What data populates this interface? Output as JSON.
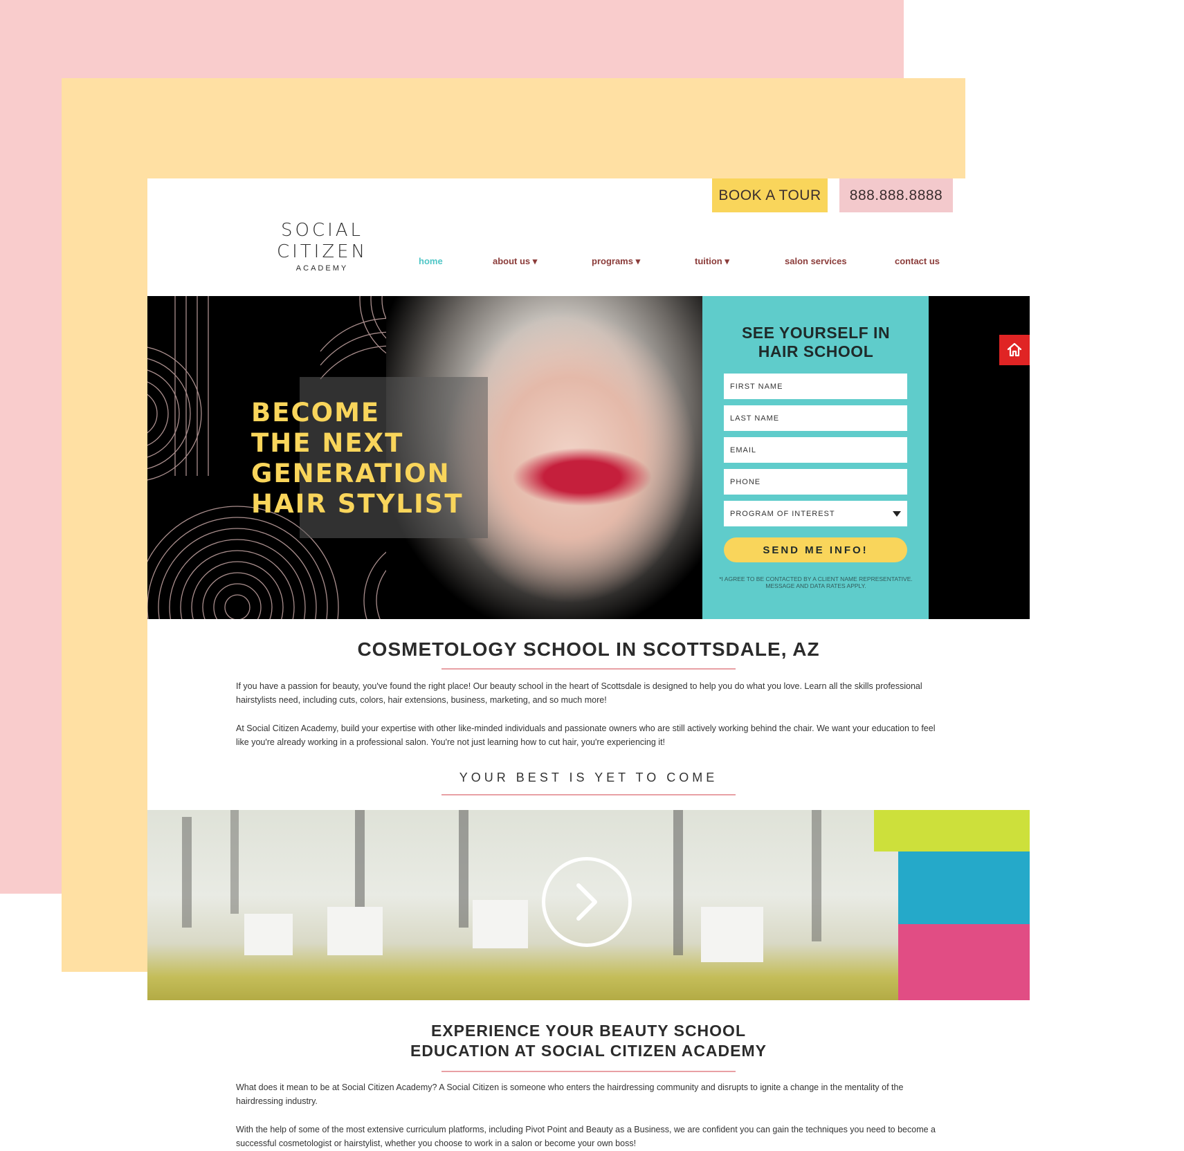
{
  "header": {
    "book_tour": "BOOK A TOUR",
    "phone": "888.888.8888"
  },
  "logo": {
    "line1": "SOCIAL",
    "line2": "CITIZEN",
    "line3": "ACADEMY"
  },
  "nav": {
    "items": [
      {
        "label": "home"
      },
      {
        "label": "about us ▾"
      },
      {
        "label": "programs ▾"
      },
      {
        "label": "tuition ▾"
      },
      {
        "label": "salon services"
      },
      {
        "label": "contact us"
      }
    ]
  },
  "hero": {
    "title_lines": [
      "BECOME",
      "THE NEXT",
      "GENERATION",
      "HAIR STYLIST"
    ]
  },
  "form": {
    "title_line1": "SEE YOURSELF IN",
    "title_line2": "HAIR SCHOOL",
    "first_name_placeholder": "FIRST NAME",
    "last_name_placeholder": "LAST NAME",
    "email_placeholder": "EMAIL",
    "phone_placeholder": "PHONE",
    "program_placeholder": "PROGRAM OF INTEREST",
    "submit_label": "SEND ME INFO!",
    "disclaimer_line1": "*I AGREE TO BE CONTACTED BY A CLIENT NAME REPRESENTATIVE.",
    "disclaimer_line2": "MESSAGE AND DATA RATES APPLY."
  },
  "section1": {
    "heading": "COSMETOLOGY SCHOOL IN SCOTTSDALE, AZ",
    "para1": "If you have a passion for beauty, you've found the right place! Our beauty school in the heart of Scottsdale is designed to help you do what you love. Learn all the skills professional hairstylists need, including cuts, colors, hair extensions, business, marketing, and so much more!",
    "para2": "At Social Citizen Academy, build your expertise with other like-minded individuals and passionate owners who are still actively working behind the chair. We want your education to feel like you're already working in a professional salon. You're not just learning how to cut hair, you're experiencing it!",
    "tagline": "YOUR BEST IS YET TO COME"
  },
  "section2": {
    "heading_line1": "EXPERIENCE YOUR BEAUTY SCHOOL",
    "heading_line2": "EDUCATION AT SOCIAL CITIZEN ACADEMY",
    "para1": "What does it mean to be at Social Citizen Academy? A Social Citizen is someone who enters the hairdressing community and disrupts to ignite a change in the mentality of the hairdressing industry.",
    "para2": "With the help of some of the most extensive curriculum platforms, including Pivot Point and Beauty as a Business, we are confident you can gain the techniques you need to become a successful cosmetologist or hairstylist, whether you choose to work in a salon or become your own boss!"
  },
  "colors": {
    "pink_bg": "#f9cccc",
    "yellow_bg": "#ffe0a3",
    "accent_yellow": "#f9d55b",
    "accent_teal": "#5fcccb",
    "nav_text": "#8b3c3a",
    "nav_active": "#4fc6c6",
    "home_badge": "#e02424",
    "underline": "#e8a0a4"
  },
  "icons": {
    "home_badge": "home-icon",
    "play": "play-icon",
    "select_caret": "caret-down-icon"
  }
}
